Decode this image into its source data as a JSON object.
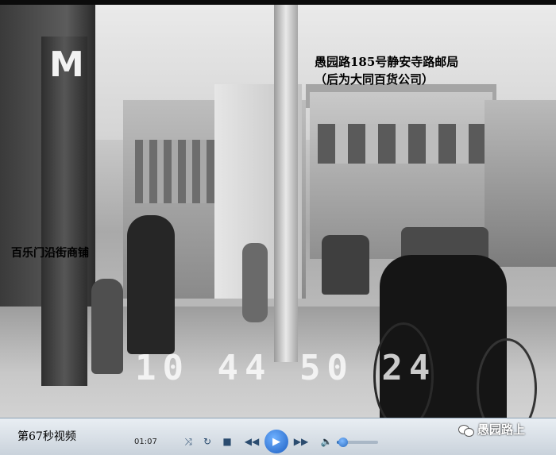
{
  "video": {
    "captions": {
      "title": "愚园路185号静安寺路邮局",
      "subtitle": "（后为大同百货公司）",
      "shops": "百乐门沿街商铺",
      "corner_mark": "M"
    },
    "timestamp": "10 44 50 24"
  },
  "player": {
    "label": "第67秒视频",
    "elapsed": "01:07",
    "volume": 0.15,
    "buttons": {
      "shuffle": "⤨",
      "repeat": "↻",
      "stop": "■",
      "prev": "◀◀",
      "play": "▶",
      "next": "▶▶",
      "mute": "🔈"
    }
  },
  "watermark": {
    "text": "愚园路上",
    "icon": "wechat-icon"
  }
}
